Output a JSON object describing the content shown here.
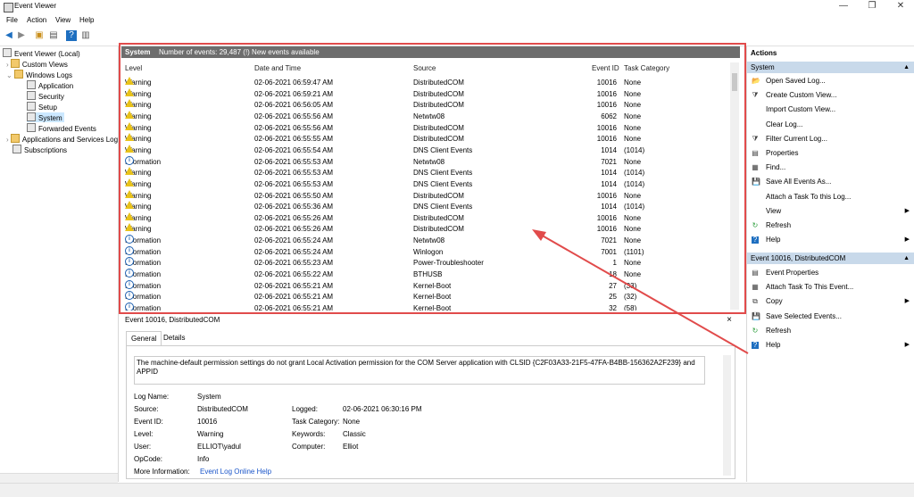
{
  "window": {
    "title": "Event Viewer",
    "minimize": "—",
    "maximize": "❐",
    "close": "✕"
  },
  "menu": [
    "File",
    "Action",
    "View",
    "Help"
  ],
  "tree": {
    "root": "Event Viewer (Local)",
    "custom_views": "Custom Views",
    "windows_logs": "Windows Logs",
    "logs": [
      "Application",
      "Security",
      "Setup",
      "System",
      "Forwarded Events"
    ],
    "apps_services": "Applications and Services Log",
    "subscriptions": "Subscriptions"
  },
  "list": {
    "title": "System",
    "count": "Number of events: 29,487 (!) New events available",
    "columns": [
      "Level",
      "Date and Time",
      "Source",
      "Event ID",
      "Task Category"
    ],
    "rows": [
      [
        "Warning",
        "02-06-2021 06:59:47 AM",
        "DistributedCOM",
        "10016",
        "None"
      ],
      [
        "Warning",
        "02-06-2021 06:59:21 AM",
        "DistributedCOM",
        "10016",
        "None"
      ],
      [
        "Warning",
        "02-06-2021 06:56:05 AM",
        "DistributedCOM",
        "10016",
        "None"
      ],
      [
        "Warning",
        "02-06-2021 06:55:56 AM",
        "Netwtw08",
        "6062",
        "None"
      ],
      [
        "Warning",
        "02-06-2021 06:55:56 AM",
        "DistributedCOM",
        "10016",
        "None"
      ],
      [
        "Warning",
        "02-06-2021 06:55:55 AM",
        "DistributedCOM",
        "10016",
        "None"
      ],
      [
        "Warning",
        "02-06-2021 06:55:54 AM",
        "DNS Client Events",
        "1014",
        "(1014)"
      ],
      [
        "Information",
        "02-06-2021 06:55:53 AM",
        "Netwtw08",
        "7021",
        "None"
      ],
      [
        "Warning",
        "02-06-2021 06:55:53 AM",
        "DNS Client Events",
        "1014",
        "(1014)"
      ],
      [
        "Warning",
        "02-06-2021 06:55:53 AM",
        "DNS Client Events",
        "1014",
        "(1014)"
      ],
      [
        "Warning",
        "02-06-2021 06:55:50 AM",
        "DistributedCOM",
        "10016",
        "None"
      ],
      [
        "Warning",
        "02-06-2021 06:55:36 AM",
        "DNS Client Events",
        "1014",
        "(1014)"
      ],
      [
        "Warning",
        "02-06-2021 06:55:26 AM",
        "DistributedCOM",
        "10016",
        "None"
      ],
      [
        "Warning",
        "02-06-2021 06:55:26 AM",
        "DistributedCOM",
        "10016",
        "None"
      ],
      [
        "Information",
        "02-06-2021 06:55:24 AM",
        "Netwtw08",
        "7021",
        "None"
      ],
      [
        "Information",
        "02-06-2021 06:55:24 AM",
        "Winlogon",
        "7001",
        "(1101)"
      ],
      [
        "Information",
        "02-06-2021 06:55:23 AM",
        "Power-Troubleshooter",
        "1",
        "None"
      ],
      [
        "Information",
        "02-06-2021 06:55:22 AM",
        "BTHUSB",
        "18",
        "None"
      ],
      [
        "Information",
        "02-06-2021 06:55:21 AM",
        "Kernel-Boot",
        "27",
        "(33)"
      ],
      [
        "Information",
        "02-06-2021 06:55:21 AM",
        "Kernel-Boot",
        "25",
        "(32)"
      ],
      [
        "Information",
        "02-06-2021 06:55:21 AM",
        "Kernel-Boot",
        "32",
        "(58)"
      ]
    ]
  },
  "detail": {
    "title": "Event 10016, DistributedCOM",
    "close": "×",
    "tabs": [
      "General",
      "Details"
    ],
    "description": "The machine-default permission settings do not grant Local Activation permission for the COM Server application with CLSID {C2F03A33-21F5-47FA-B4BB-156362A2F239} and APPID",
    "fields": {
      "log_name_label": "Log Name:",
      "log_name": "System",
      "source_label": "Source:",
      "source": "DistributedCOM",
      "logged_label": "Logged:",
      "logged": "02-06-2021 06:30:16 PM",
      "event_id_label": "Event ID:",
      "event_id": "10016",
      "task_category_label": "Task Category:",
      "task_category": "None",
      "level_label": "Level:",
      "level": "Warning",
      "keywords_label": "Keywords:",
      "keywords": "Classic",
      "user_label": "User:",
      "user": "ELLIOT\\yadul",
      "computer_label": "Computer:",
      "computer": "Elliot",
      "opcode_label": "OpCode:",
      "opcode": "Info",
      "more_info_label": "More Information:",
      "more_info": "Event Log Online Help"
    }
  },
  "actions": {
    "header": "Actions",
    "group1": "System",
    "group1_items": [
      "Open Saved Log...",
      "Create Custom View...",
      "Import Custom View...",
      "Clear Log...",
      "Filter Current Log...",
      "Properties",
      "Find...",
      "Save All Events As...",
      "Attach a Task To this Log...",
      "View",
      "Refresh",
      "Help"
    ],
    "group2": "Event 10016, DistributedCOM",
    "group2_items": [
      "Event Properties",
      "Attach Task To This Event...",
      "Copy",
      "Save Selected Events...",
      "Refresh",
      "Help"
    ]
  },
  "colors": {
    "highlight": "#e14b4b",
    "group_header": "#c8d9ea",
    "list_header": "#6d6d6d",
    "link": "#1a55c9"
  }
}
